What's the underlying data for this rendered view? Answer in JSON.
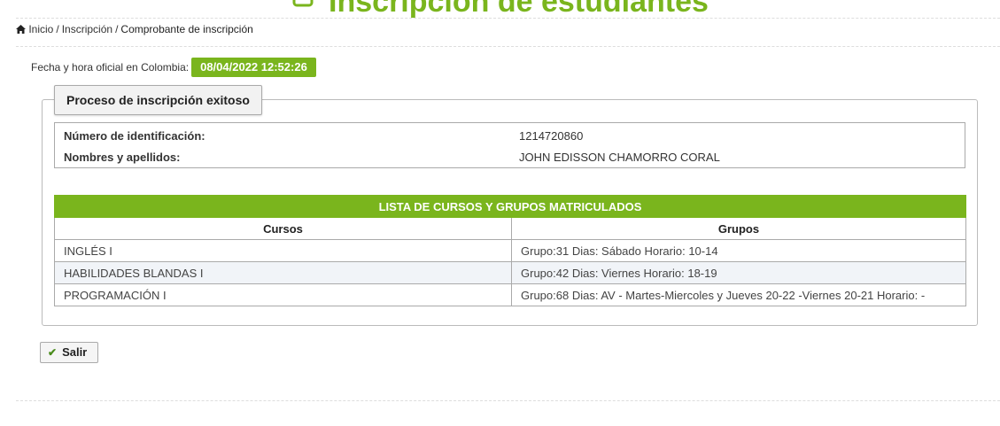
{
  "page": {
    "title": "Inscripción de estudiantes",
    "title_icon": "edit-icon"
  },
  "breadcrumb": {
    "home_icon": "home-icon",
    "items": [
      "Inicio",
      "Inscripción",
      "Comprobante de inscripción"
    ],
    "separator": "/"
  },
  "datetime": {
    "label": "Fecha y hora oficial en Colombia:",
    "value": "08/04/2022 12:52:26",
    "badge_color": "#7ab51d"
  },
  "result": {
    "legend": "Proceso de inscripción exitoso",
    "rows": [
      {
        "label": "Número de identificación:",
        "value": "1214720860"
      },
      {
        "label": "Nombres y apellidos:",
        "value": "JOHN EDISSON CHAMORRO CORAL"
      }
    ]
  },
  "courses": {
    "caption": "LISTA DE CURSOS Y GRUPOS MATRICULADOS",
    "headers": [
      "Cursos",
      "Grupos"
    ],
    "rows": [
      {
        "curso": "INGLÉS I",
        "grupo": "Grupo:31 Dias: Sábado Horario: 10-14"
      },
      {
        "curso": "HABILIDADES BLANDAS I",
        "grupo": "Grupo:42 Dias: Viernes Horario: 18-19"
      },
      {
        "curso": "PROGRAMACIÓN I",
        "grupo": "Grupo:68 Dias: AV - Martes-Miercoles y Jueves 20-22 -Viernes 20-21 Horario: -"
      }
    ],
    "header_color": "#7ab51d"
  },
  "actions": {
    "exit_label": "Salir",
    "exit_icon": "check-icon"
  }
}
